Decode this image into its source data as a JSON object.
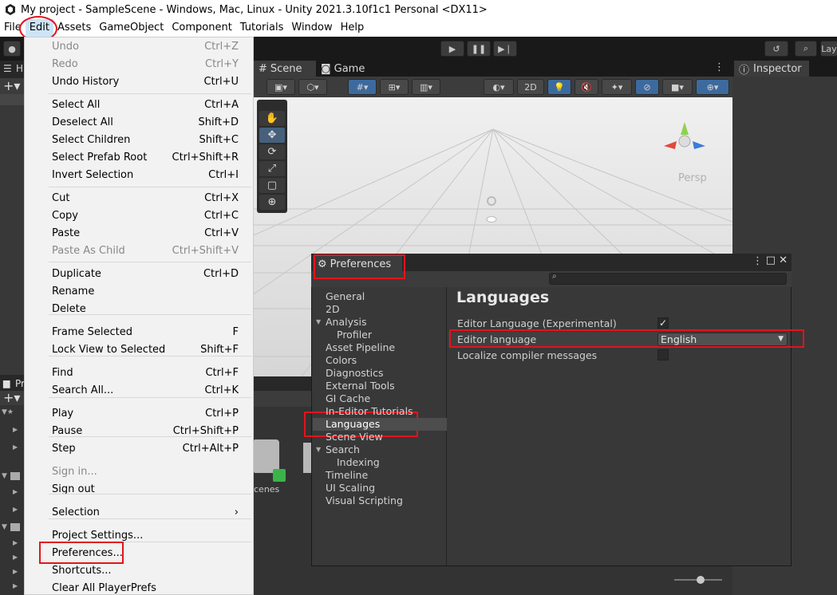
{
  "window": {
    "title": "My project - SampleScene - Windows, Mac, Linux - Unity 2021.3.10f1c1 Personal <DX11>"
  },
  "menubar": [
    "File",
    "Edit",
    "Assets",
    "GameObject",
    "Component",
    "Tutorials",
    "Window",
    "Help"
  ],
  "toolbar": {
    "layers_label": "Lay"
  },
  "left_panels": {
    "hierarchy_tab": "H",
    "project_tab": "Pr"
  },
  "scene": {
    "tab_scene": "Scene",
    "tab_game": "Game",
    "btn_2d": "2D",
    "persp_label": "Persp"
  },
  "project_area": {
    "folder_label": "cenes"
  },
  "inspector": {
    "tab": "Inspector"
  },
  "edit_menu": {
    "items": [
      {
        "label": "Undo",
        "shortcut": "Ctrl+Z",
        "disabled": true
      },
      {
        "label": "Redo",
        "shortcut": "Ctrl+Y",
        "disabled": true
      },
      {
        "label": "Undo History",
        "shortcut": "Ctrl+U",
        "disabled": false
      },
      {
        "label": "Select All",
        "shortcut": "Ctrl+A",
        "disabled": false
      },
      {
        "label": "Deselect All",
        "shortcut": "Shift+D",
        "disabled": false
      },
      {
        "label": "Select Children",
        "shortcut": "Shift+C",
        "disabled": false
      },
      {
        "label": "Select Prefab Root",
        "shortcut": "Ctrl+Shift+R",
        "disabled": false
      },
      {
        "label": "Invert Selection",
        "shortcut": "Ctrl+I",
        "disabled": false
      },
      {
        "label": "Cut",
        "shortcut": "Ctrl+X",
        "disabled": false
      },
      {
        "label": "Copy",
        "shortcut": "Ctrl+C",
        "disabled": false
      },
      {
        "label": "Paste",
        "shortcut": "Ctrl+V",
        "disabled": false
      },
      {
        "label": "Paste As Child",
        "shortcut": "Ctrl+Shift+V",
        "disabled": true
      },
      {
        "label": "Duplicate",
        "shortcut": "Ctrl+D",
        "disabled": false
      },
      {
        "label": "Rename",
        "shortcut": "",
        "disabled": false
      },
      {
        "label": "Delete",
        "shortcut": "",
        "disabled": false
      },
      {
        "label": "Frame Selected",
        "shortcut": "F",
        "disabled": false
      },
      {
        "label": "Lock View to Selected",
        "shortcut": "Shift+F",
        "disabled": false
      },
      {
        "label": "Find",
        "shortcut": "Ctrl+F",
        "disabled": false
      },
      {
        "label": "Search All...",
        "shortcut": "Ctrl+K",
        "disabled": false
      },
      {
        "label": "Play",
        "shortcut": "Ctrl+P",
        "disabled": false
      },
      {
        "label": "Pause",
        "shortcut": "Ctrl+Shift+P",
        "disabled": false
      },
      {
        "label": "Step",
        "shortcut": "Ctrl+Alt+P",
        "disabled": false
      },
      {
        "label": "Sign in...",
        "shortcut": "",
        "disabled": true
      },
      {
        "label": "Sign out",
        "shortcut": "",
        "disabled": false
      },
      {
        "label": "Selection",
        "shortcut": "›",
        "disabled": false
      },
      {
        "label": "Project Settings...",
        "shortcut": "",
        "disabled": false
      },
      {
        "label": "Preferences...",
        "shortcut": "",
        "disabled": false
      },
      {
        "label": "Shortcuts...",
        "shortcut": "",
        "disabled": false
      },
      {
        "label": "Clear All PlayerPrefs",
        "shortcut": "",
        "disabled": false
      }
    ]
  },
  "preferences": {
    "tab": "Preferences",
    "search_placeholder": "",
    "nav": [
      "General",
      "2D",
      "Analysis",
      "Profiler",
      "Asset Pipeline",
      "Colors",
      "Diagnostics",
      "External Tools",
      "GI Cache",
      "In-Editor Tutorials",
      "Languages",
      "Scene View",
      "Search",
      "Indexing",
      "Timeline",
      "UI Scaling",
      "Visual Scripting"
    ],
    "selected": "Languages",
    "title": "Languages",
    "rows": {
      "experimental_label": "Editor Language (Experimental)",
      "experimental_checked": true,
      "language_label": "Editor language",
      "language_value": "English",
      "localize_label": "Localize compiler messages",
      "localize_checked": false
    }
  },
  "colors": {
    "annotation_red": "#e3141b",
    "unity_dark": "#383838",
    "menu_bg": "#f2f2f2",
    "selected_blue": "#cce4f7"
  }
}
